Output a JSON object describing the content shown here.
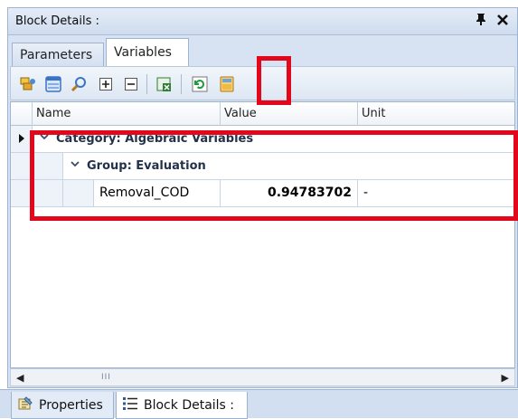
{
  "panel": {
    "title": "Block Details :",
    "pin": "ᵖ",
    "close": "✕"
  },
  "tabs": [
    {
      "label": "Parameters",
      "active": false
    },
    {
      "label": "Variables",
      "active": true
    }
  ],
  "toolbar": {
    "buttons": [
      {
        "icon": "display-settings-icon"
      },
      {
        "icon": "table-view-icon"
      },
      {
        "icon": "search-icon"
      },
      {
        "icon": "expand-all-icon"
      },
      {
        "icon": "collapse-all-icon"
      },
      {
        "icon": "export-excel-icon"
      },
      {
        "icon": "refresh-icon"
      },
      {
        "icon": "calculator-icon"
      }
    ]
  },
  "grid": {
    "columns": [
      "Name",
      "Value",
      "Unit"
    ],
    "category": "Category: Algebraic Variables",
    "group": "Group: Evaluation",
    "rows": [
      {
        "name": "Removal_COD",
        "value": "0.94783702",
        "unit": "-"
      }
    ]
  },
  "scrollbar": {
    "left_arrow": "◀",
    "right_arrow": "▶",
    "grip": "III"
  },
  "bottom_tabs": [
    {
      "label": "Properties",
      "icon": "properties-icon"
    },
    {
      "label": "Block Details :",
      "icon": "list-icon"
    }
  ],
  "colors": {
    "highlight": "#e2071a",
    "panel_bg": "#d7e3f2"
  }
}
